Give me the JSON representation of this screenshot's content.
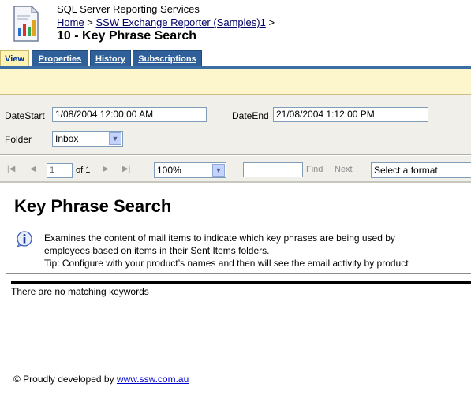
{
  "header": {
    "app_title": "SQL Server Reporting Services",
    "breadcrumb": {
      "home": "Home",
      "sep1": " > ",
      "folder": "SSW Exchange Reporter (Samples)1",
      "sep2": " >"
    },
    "page_title": "10 - Key Phrase Search"
  },
  "tabs": [
    {
      "label": "View",
      "active": true
    },
    {
      "label": "Properties",
      "active": false
    },
    {
      "label": "History",
      "active": false
    },
    {
      "label": "Subscriptions",
      "active": false
    }
  ],
  "params": {
    "date_start_label": "DateStart",
    "date_start_value": "1/08/2004 12:00:00 AM",
    "date_end_label": "DateEnd",
    "date_end_value": "21/08/2004 1:12:00 PM",
    "folder_label": "Folder",
    "folder_value": "Inbox"
  },
  "toolbar": {
    "page_value": "1",
    "of_text": "of 1",
    "zoom_value": "100%",
    "find_label": "Find",
    "separator": "|",
    "next_label": "Next",
    "format_value": "Select a format"
  },
  "report": {
    "title": "Key Phrase Search",
    "description_line1": "Examines the content of mail items to indicate which key phrases are being used by",
    "description_line2": "employees based on items in their Sent Items folders.",
    "description_line3": "Tip: Configure with your product’s names and then will see the email activity by product",
    "no_match": "There are no matching keywords",
    "footer_prefix": "© Proudly developed by ",
    "footer_link": "www.ssw.com.au"
  },
  "icons": {
    "report_icon": "report-document-icon",
    "info_icon": "info-icon",
    "first_page": "first-page-icon",
    "prev_page": "previous-page-icon",
    "next_page": "next-page-icon",
    "last_page": "last-page-icon",
    "dropdown": "chevron-down-icon"
  },
  "colors": {
    "tab_active_bg": "#fff3b3",
    "tab_inactive_bg": "#2f6099",
    "tab_bar": "#3a6ea5",
    "param_bg": "#f0efea",
    "link": "#0000cc"
  }
}
